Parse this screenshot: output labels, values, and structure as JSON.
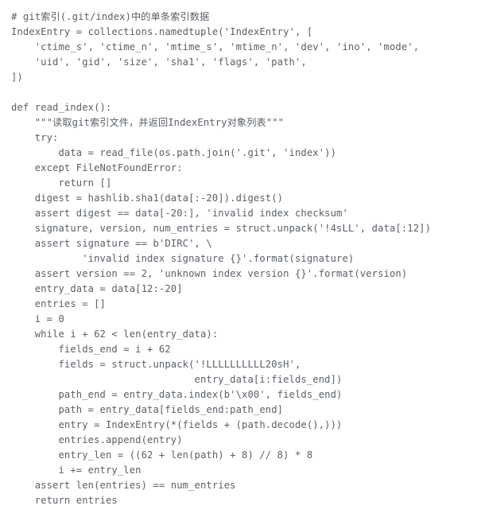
{
  "code": {
    "lines": [
      "# git索引(.git/index)中的单条索引数据",
      "IndexEntry = collections.namedtuple('IndexEntry', [",
      "    'ctime_s', 'ctime_n', 'mtime_s', 'mtime_n', 'dev', 'ino', 'mode',",
      "    'uid', 'gid', 'size', 'sha1', 'flags', 'path',",
      "])",
      "",
      "def read_index():",
      "    \"\"\"读取git索引文件，并返回IndexEntry对象列表\"\"\"",
      "    try:",
      "        data = read_file(os.path.join('.git', 'index'))",
      "    except FileNotFoundError:",
      "        return []",
      "    digest = hashlib.sha1(data[:-20]).digest()",
      "    assert digest == data[-20:], 'invalid index checksum'",
      "    signature, version, num_entries = struct.unpack('!4sLL', data[:12])",
      "    assert signature == b'DIRC', \\",
      "            'invalid index signature {}'.format(signature)",
      "    assert version == 2, 'unknown index version {}'.format(version)",
      "    entry_data = data[12:-20]",
      "    entries = []",
      "    i = 0",
      "    while i + 62 < len(entry_data):",
      "        fields_end = i + 62",
      "        fields = struct.unpack('!LLLLLLLLLL20sH',",
      "                               entry_data[i:fields_end])",
      "        path_end = entry_data.index(b'\\x00', fields_end)",
      "        path = entry_data[fields_end:path_end]",
      "        entry = IndexEntry(*(fields + (path.decode(),)))",
      "        entries.append(entry)",
      "        entry_len = ((62 + len(path) + 8) // 8) * 8",
      "        i += entry_len",
      "    assert len(entries) == num_entries",
      "    return entries"
    ]
  }
}
